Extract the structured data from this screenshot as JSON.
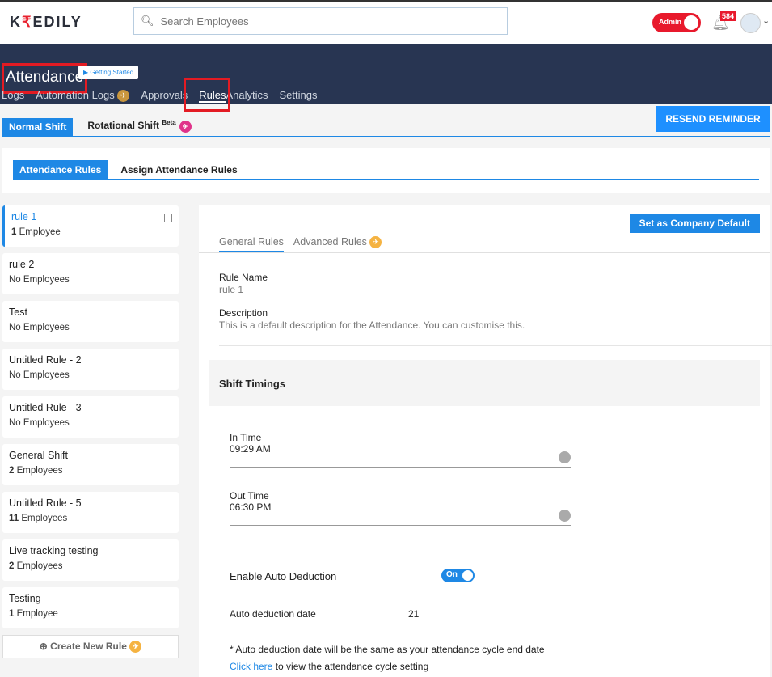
{
  "app": {
    "logo": "KREDILY",
    "search_placeholder": "Search Employees",
    "admin_label": "Admin",
    "notification_count": "584"
  },
  "header": {
    "title": "Attendance",
    "getting_started": "▶ Getting Started",
    "nav": [
      "Logs",
      "Automation Logs",
      "Approvals",
      "Rules",
      "Analytics",
      "Settings"
    ],
    "active_nav": "Rules"
  },
  "shift_tabs": {
    "normal": "Normal Shift",
    "rotational": "Rotational Shift",
    "beta": "Beta"
  },
  "resend_label": "RESEND REMINDER",
  "rule_tabs": [
    "Attendance Rules",
    "Assign Attendance Rules"
  ],
  "rules": [
    {
      "name": "rule 1",
      "count": "1",
      "count_label": " Employee"
    },
    {
      "name": "rule 2",
      "count": "",
      "count_label": "No Employees"
    },
    {
      "name": "Test",
      "count": "",
      "count_label": "No Employees"
    },
    {
      "name": "Untitled Rule - 2",
      "count": "",
      "count_label": "No Employees"
    },
    {
      "name": "Untitled Rule - 3",
      "count": "",
      "count_label": "No Employees"
    },
    {
      "name": "General Shift",
      "count": "2",
      "count_label": " Employees"
    },
    {
      "name": "Untitled Rule - 5",
      "count": "11",
      "count_label": " Employees"
    },
    {
      "name": "Live tracking testing",
      "count": "2",
      "count_label": " Employees"
    },
    {
      "name": "Testing",
      "count": "1",
      "count_label": " Employee"
    }
  ],
  "create_rule": "Create New Rule",
  "detail": {
    "set_default": "Set as Company Default",
    "tabs": [
      "General Rules",
      "Advanced Rules"
    ],
    "rule_name_label": "Rule Name",
    "rule_name": "rule 1",
    "description_label": "Description",
    "description": "This is a default description for the Attendance. You can customise this.",
    "shift_timings": "Shift Timings",
    "in_time_label": "In Time",
    "in_time": "09:29 AM",
    "out_time_label": "Out Time",
    "out_time": "06:30 PM",
    "auto_deduction_label": "Enable Auto Deduction",
    "auto_deduction_state": "On",
    "auto_deduction_date_label": "Auto deduction date",
    "auto_deduction_date": "21",
    "note": "* Auto deduction date will be the same as your attendance cycle end date",
    "click_here": "Click here",
    "click_here_suffix": " to view the attendance cycle setting"
  },
  "colors": {
    "accent": "#1e88e5",
    "header_bg": "#283552",
    "alert": "#e8192c"
  }
}
